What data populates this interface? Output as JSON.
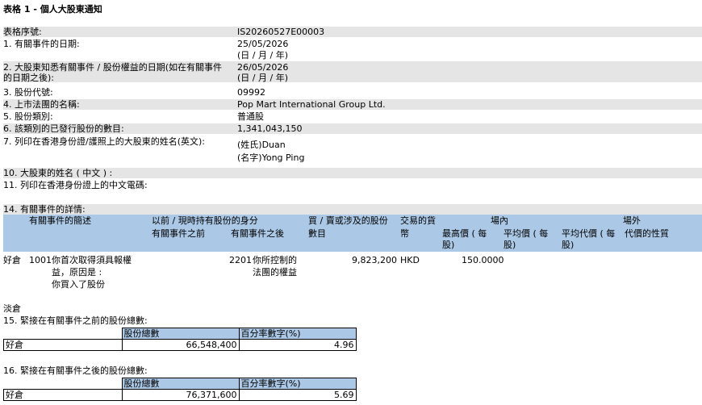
{
  "title": "表格 1 - 個人大股東通知",
  "rows": [
    {
      "label": "表格序號:",
      "value": "IS20260527E00003"
    },
    {
      "label": "1. 有關事件的日期:",
      "value": "25/05/2026",
      "sub": "(日 / 月 / 年)"
    },
    {
      "label": "2. 大股東知悉有關事件 / 股份權益的日期(如在有關事件",
      "label2": "的日期之後):",
      "value": "26/05/2026",
      "sub": "(日 / 月 / 年)"
    },
    {
      "label": "3. 股份代號:",
      "value": "09992"
    },
    {
      "label": "4. 上市法團的名稱:",
      "value": "Pop Mart International Group Ltd."
    },
    {
      "label": "5. 股份類別:",
      "value": "普通股"
    },
    {
      "label": "6. 該類別的已發行股份的數目:",
      "value": "1,341,043,150"
    },
    {
      "label": "7. 列印在香港身份證/護照上的大股東的姓名(英文):",
      "value": "(姓氏)Duan",
      "sub": "(名字)Yong Ping"
    },
    {
      "label": "10. 大股東的姓名 ( 中文 ) :"
    },
    {
      "label": "11. 列印在香港身份證上的中文電碼:"
    }
  ],
  "section14": {
    "label": "14. 有關事件的詳情:",
    "headers": {
      "event_code": "有關事件的簡述",
      "capacity_top": "以前 / 現時持有股份的身分",
      "capacity_before": "有關事件之前",
      "capacity_after": "有關事件之後",
      "shares_top": "買 / 賣或涉及的股份",
      "shares_bottom": "數目",
      "currency_top": "交易的貨",
      "currency_bottom": "幣",
      "on_exchange": "場內",
      "off_exchange": "場外",
      "high_top": "最高價 ( 每",
      "high_bottom": "股)",
      "avg_top": "平均價 ( 每",
      "avg_bottom": "股)",
      "avg_cons_top": "平均代價 ( 每",
      "avg_cons_bottom": "股)",
      "cons_nature": "代價的性質"
    },
    "row": {
      "position": "好倉",
      "code": "1001",
      "desc1": "你首次取得須具報權",
      "desc2": "益，原因是 :",
      "desc3": "你買入了股份",
      "cap_code": "2201",
      "cap1": "你所控制的",
      "cap2": "法團的權益",
      "shares": "9,823,200",
      "currency": "HKD",
      "high": "150.0000"
    },
    "short_label": "淡倉"
  },
  "section15": {
    "label": "15. 緊接在有關事件之前的股份總數:",
    "col_shares": "股份總數",
    "col_pct": "百分率數字(%)",
    "row_label": "好倉",
    "shares": "66,548,400",
    "pct": "4.96"
  },
  "section16": {
    "label": "16. 緊接在有關事件之後的股份總數:",
    "col_shares": "股份總數",
    "col_pct": "百分率數字(%)",
    "row_label": "好倉",
    "shares": "76,371,600",
    "pct": "5.69"
  }
}
